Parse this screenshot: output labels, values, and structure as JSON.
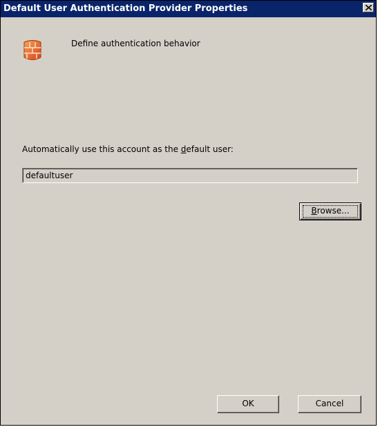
{
  "window": {
    "title": "Default User Authentication Provider Properties"
  },
  "titlebar": {
    "close_glyph": "✕"
  },
  "header": {
    "text": "Define authentication behavior",
    "icon": "firewall-icon"
  },
  "prompt": {
    "before": "Automatically use this account as the ",
    "underlined": "d",
    "after": "efault user:"
  },
  "account_field": {
    "value": "defaultuser"
  },
  "buttons": {
    "browse": {
      "underlined": "B",
      "rest": "rowse..."
    },
    "ok": "OK",
    "cancel": "Cancel"
  },
  "colors": {
    "titlebar": "#0a246a",
    "dialog": "#d4d0c8",
    "icon_orange": "#e8642c"
  }
}
